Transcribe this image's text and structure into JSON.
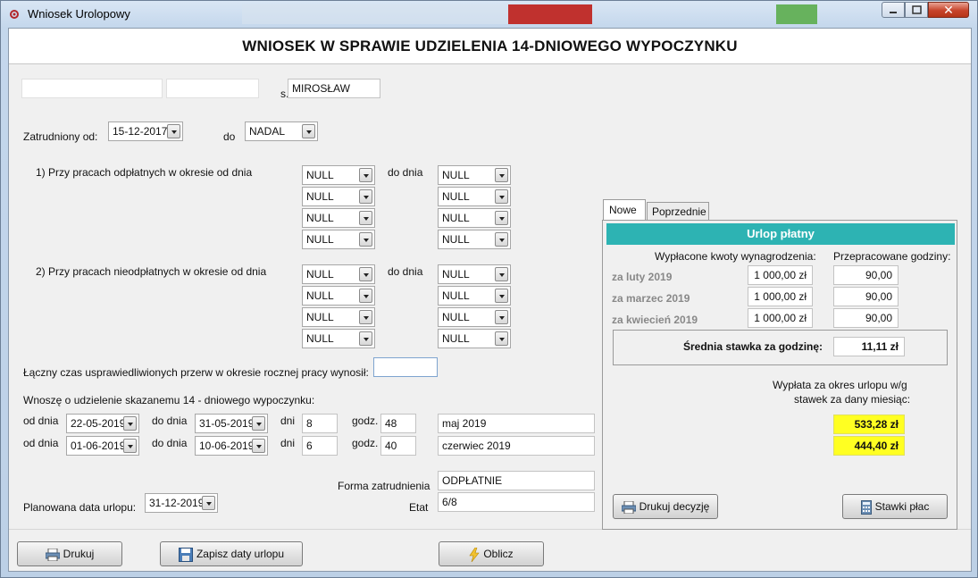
{
  "window": {
    "title": "Wniosek Urolopowy"
  },
  "form": {
    "title": "WNIOSEK W SPRAWIE UDZIELENIA 14-DNIOWEGO WYPOCZYNKU"
  },
  "person": {
    "first_name": "",
    "last_name": "",
    "son_of_label": "s.",
    "father_name": "MIROSŁAW"
  },
  "employment": {
    "from_label": "Zatrudniony od:",
    "from_value": "15-12-2017",
    "to_label": "do",
    "to_value": "NADAL"
  },
  "paid_periods": {
    "label": "1) Przy pracach odpłatnych w okresie od dnia",
    "to_label": "do dnia",
    "from": [
      "NULL",
      "NULL",
      "NULL",
      "NULL"
    ],
    "to": [
      "NULL",
      "NULL",
      "NULL",
      "NULL"
    ]
  },
  "unpaid_periods": {
    "label": "2) Przy pracach nieodpłatnych w okresie od dnia",
    "to_label": "do dnia",
    "from": [
      "NULL",
      "NULL",
      "NULL",
      "NULL"
    ],
    "to": [
      "NULL",
      "NULL",
      "NULL",
      "NULL"
    ]
  },
  "breaks": {
    "label": "Łączny czas usprawiedliwionych przerw w okresie rocznej pracy wynosił:",
    "value": ""
  },
  "request": {
    "label": "Wnoszę o udzielenie skazanemu 14 - dniowego wypoczynku:",
    "rows": [
      {
        "od_label": "od dnia",
        "od": "22-05-2019",
        "do_label": "do dnia",
        "do": "31-05-2019",
        "dni_label": "dni",
        "dni": "8",
        "godz_label": "godz.",
        "godz": "48",
        "month": "maj 2019"
      },
      {
        "od_label": "od dnia",
        "od": "01-06-2019",
        "do_label": "do dnia",
        "do": "10-06-2019",
        "dni_label": "dni",
        "dni": "6",
        "godz_label": "godz.",
        "godz": "40",
        "month": "czerwiec 2019"
      }
    ]
  },
  "employment_form": {
    "label": "Forma zatrudnienia",
    "value": "ODPŁATNIE"
  },
  "etat": {
    "label": "Etat",
    "value": "6/8"
  },
  "planned": {
    "label": "Planowana data urlopu:",
    "value": "31-12-2019"
  },
  "buttons": {
    "print": "Drukuj",
    "save_dates": "Zapisz daty urlopu",
    "calculate": "Oblicz"
  },
  "panel": {
    "tabs": [
      "Nowe",
      "Poprzednie"
    ],
    "header": "Urlop płatny",
    "col_paid": "Wypłacone kwoty wynagrodzenia:",
    "col_hours": "Przepracowane godziny:",
    "months": [
      {
        "label": "za luty 2019",
        "amount": "1 000,00 zł",
        "hours": "90,00"
      },
      {
        "label": "za marzec 2019",
        "amount": "1 000,00 zł",
        "hours": "90,00"
      },
      {
        "label": "za kwiecień 2019",
        "amount": "1 000,00 zł",
        "hours": "90,00"
      }
    ],
    "avg_label": "Średnia stawka za godzinę:",
    "avg_value": "11,11 zł",
    "payout_label_1": "Wypłata za okres urlopu w/g",
    "payout_label_2": "stawek za dany miesiąc:",
    "payouts": [
      "533,28 zł",
      "444,40 zł"
    ],
    "print_decision": "Drukuj decyzję",
    "rates": "Stawki płac"
  },
  "colors": {
    "accent": "#2db3b3",
    "highlight": "#ffff22"
  }
}
